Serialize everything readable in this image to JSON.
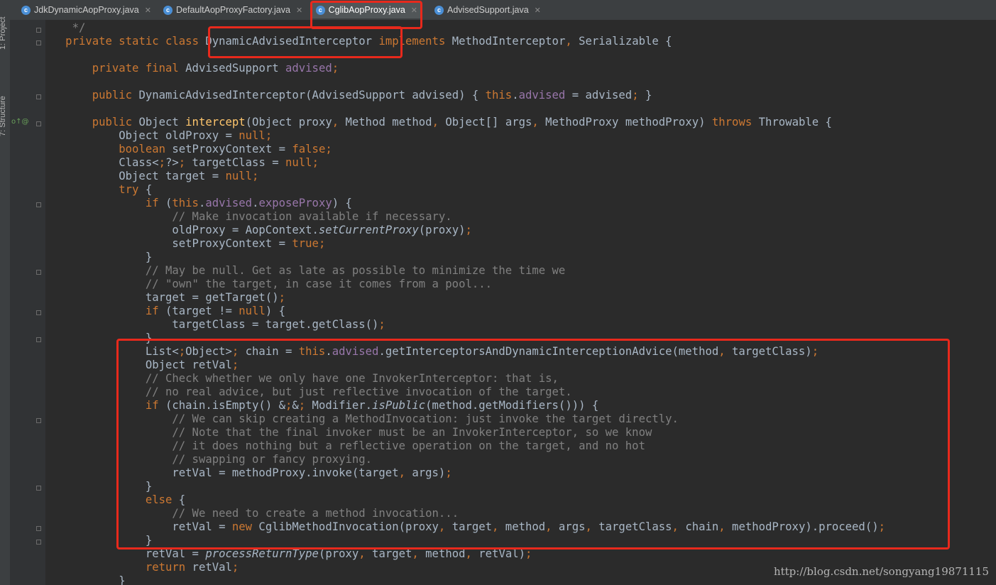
{
  "window": {
    "left_tabs": [
      "1: Project",
      "7: Structure"
    ]
  },
  "tabs": [
    {
      "label": "JdkDynamicAopProxy.java",
      "active": false
    },
    {
      "label": "DefaultAopProxyFactory.java",
      "active": false
    },
    {
      "label": "CglibAopProxy.java",
      "active": true
    },
    {
      "label": "AdvisedSupport.java",
      "active": false
    }
  ],
  "code": {
    "lines": [
      "    */",
      "   private static class DynamicAdvisedInterceptor implements MethodInterceptor, Serializable {",
      "",
      "       private final AdvisedSupport advised;",
      "",
      "       public DynamicAdvisedInterceptor(AdvisedSupport advised) { this.advised = advised; }",
      "",
      "       public Object intercept(Object proxy, Method method, Object[] args, MethodProxy methodProxy) throws Throwable {",
      "           Object oldProxy = null;",
      "           boolean setProxyContext = false;",
      "           Class<?> targetClass = null;",
      "           Object target = null;",
      "           try {",
      "               if (this.advised.exposeProxy) {",
      "                   // Make invocation available if necessary.",
      "                   oldProxy = AopContext.setCurrentProxy(proxy);",
      "                   setProxyContext = true;",
      "               }",
      "               // May be null. Get as late as possible to minimize the time we",
      "               // \"own\" the target, in case it comes from a pool...",
      "               target = getTarget();",
      "               if (target != null) {",
      "                   targetClass = target.getClass();",
      "               }",
      "               List<Object> chain = this.advised.getInterceptorsAndDynamicInterceptionAdvice(method, targetClass);",
      "               Object retVal;",
      "               // Check whether we only have one InvokerInterceptor: that is,",
      "               // no real advice, but just reflective invocation of the target.",
      "               if (chain.isEmpty() && Modifier.isPublic(method.getModifiers())) {",
      "                   // We can skip creating a MethodInvocation: just invoke the target directly.",
      "                   // Note that the final invoker must be an InvokerInterceptor, so we know",
      "                   // it does nothing but a reflective operation on the target, and no hot",
      "                   // swapping or fancy proxying.",
      "                   retVal = methodProxy.invoke(target, args);",
      "               }",
      "               else {",
      "                   // We need to create a method invocation...",
      "                   retVal = new CglibMethodInvocation(proxy, target, method, args, targetClass, chain, methodProxy).proceed();",
      "               }",
      "               retVal = processReturnType(proxy, target, method, retVal);",
      "               return retVal;",
      "           }"
    ]
  },
  "watermark": "http://blog.csdn.net/songyang19871115",
  "colors": {
    "background": "#2b2b2b",
    "keyword": "#cc7832",
    "comment": "#808080",
    "field": "#9876aa",
    "method_decl": "#ffc66d",
    "plain": "#a9b7c6",
    "annotation_box": "#e8291c"
  },
  "icons": {
    "tab": "class-c-icon",
    "gutter": "override-implement-icon"
  }
}
